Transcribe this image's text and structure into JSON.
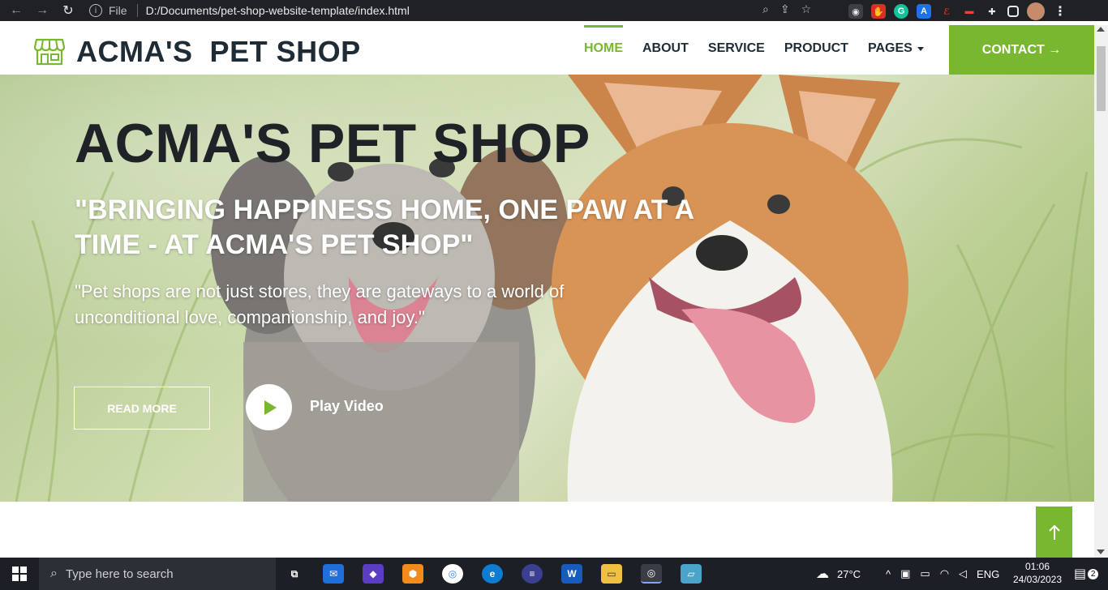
{
  "browser": {
    "file_label": "File",
    "url": "D:/Documents/pet-shop-website-template/index.html",
    "extensions": [
      "ext-red-icon",
      "ext-grammarly-icon",
      "ext-a-icon",
      "ext-cursive-icon",
      "ext-mask-icon"
    ]
  },
  "header": {
    "logo_text": "ACMA'S  PET SHOP",
    "menu": [
      {
        "label": "HOME",
        "active": true
      },
      {
        "label": "ABOUT"
      },
      {
        "label": "SERVICE"
      },
      {
        "label": "PRODUCT"
      },
      {
        "label": "PAGES"
      }
    ],
    "contact_label": "CONTACT →"
  },
  "hero": {
    "title": "ACMA'S PET SHOP",
    "tagline": "\"BRINGING HAPPINESS HOME, ONE PAW AT A TIME - AT ACMA'S PET SHOP\"",
    "quote": "\"Pet shops are not just stores, they are gateways to a world of unconditional love, companionship, and joy.\"",
    "read_more_label": "READ MORE",
    "play_video_label": "Play Video"
  },
  "taskbar": {
    "search_placeholder": "Type here to search",
    "weather": "27°C",
    "language": "ENG",
    "time": "01:06",
    "date": "24/03/2023",
    "notification_count": "2"
  },
  "colors": {
    "accent": "#7ab730",
    "dark": "#1f2c36"
  }
}
